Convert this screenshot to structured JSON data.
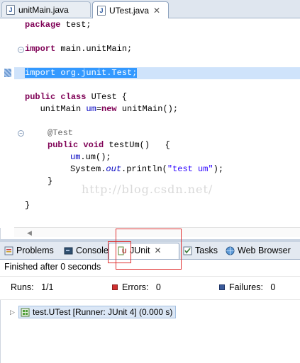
{
  "editor_tabs": [
    {
      "label": "unitMain.java",
      "icon": "java-file-icon"
    },
    {
      "label": "UTest.java",
      "icon": "java-file-icon",
      "active": true
    }
  ],
  "code": {
    "line1": {
      "kw": "package",
      "rest": " test;"
    },
    "line2": {
      "kw": "import",
      "rest": " main.unitMain;"
    },
    "line3": {
      "text": "import org.junit.Test;"
    },
    "line4": {
      "kw1": "public",
      "kw2": " class",
      "rest": " UTest {"
    },
    "line5": {
      "pre": "   unitMain ",
      "fld": "um",
      "mid": "=",
      "kw": "new",
      "rest": " unitMain();"
    },
    "line6": {
      "ann": "@Test"
    },
    "line7": {
      "kw1": "public",
      "kw2": " void",
      "rest": " testUm()   {"
    },
    "line8": {
      "fld": "um",
      "rest": ".um();"
    },
    "line9": {
      "pre": "System.",
      "fld": "out",
      "mid": ".println(",
      "str": "\"test um\"",
      "rest": ");"
    },
    "line10": {
      "text": "}"
    },
    "line11": {
      "text": "}"
    }
  },
  "watermark": "http://blog.csdn.net/",
  "panel_tabs": [
    {
      "label": "Problems"
    },
    {
      "label": "Console"
    },
    {
      "label": "JUnit",
      "active": true
    },
    {
      "label": "Tasks"
    },
    {
      "label": "Web Browser"
    }
  ],
  "junit": {
    "status": "Finished after 0 seconds",
    "runs_label": "Runs:",
    "runs_value": "1/1",
    "errors_label": "Errors:",
    "errors_value": "0",
    "failures_label": "Failures:",
    "failures_value": "0",
    "result_row": "test.UTest [Runner: JUnit 4] (0.000 s)"
  },
  "colors": {
    "keyword": "#7f0055",
    "selection": "#3399ff",
    "highlight_box": "#e03030"
  }
}
